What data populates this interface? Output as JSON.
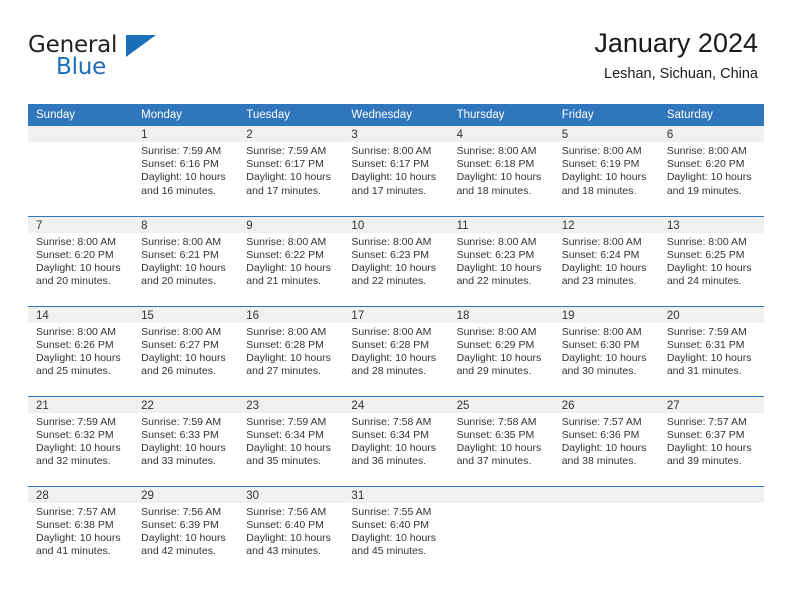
{
  "brand": {
    "word_one": "General",
    "word_two": "Blue",
    "triangle_icon": "triangle-right-icon",
    "accent_color": "#1b6fb8"
  },
  "header": {
    "title": "January 2024",
    "subtitle": "Leshan, Sichuan, China"
  },
  "calendar": {
    "header_bg": "#3076bd",
    "daynum_bg": "#f0f0f0",
    "columns": [
      "Sunday",
      "Monday",
      "Tuesday",
      "Wednesday",
      "Thursday",
      "Friday",
      "Saturday"
    ],
    "weeks": [
      [
        {
          "day": "",
          "lines": []
        },
        {
          "day": "1",
          "lines": [
            "Sunrise: 7:59 AM",
            "Sunset: 6:16 PM",
            "Daylight: 10 hours",
            "and 16 minutes."
          ]
        },
        {
          "day": "2",
          "lines": [
            "Sunrise: 7:59 AM",
            "Sunset: 6:17 PM",
            "Daylight: 10 hours",
            "and 17 minutes."
          ]
        },
        {
          "day": "3",
          "lines": [
            "Sunrise: 8:00 AM",
            "Sunset: 6:17 PM",
            "Daylight: 10 hours",
            "and 17 minutes."
          ]
        },
        {
          "day": "4",
          "lines": [
            "Sunrise: 8:00 AM",
            "Sunset: 6:18 PM",
            "Daylight: 10 hours",
            "and 18 minutes."
          ]
        },
        {
          "day": "5",
          "lines": [
            "Sunrise: 8:00 AM",
            "Sunset: 6:19 PM",
            "Daylight: 10 hours",
            "and 18 minutes."
          ]
        },
        {
          "day": "6",
          "lines": [
            "Sunrise: 8:00 AM",
            "Sunset: 6:20 PM",
            "Daylight: 10 hours",
            "and 19 minutes."
          ]
        }
      ],
      [
        {
          "day": "7",
          "lines": [
            "Sunrise: 8:00 AM",
            "Sunset: 6:20 PM",
            "Daylight: 10 hours",
            "and 20 minutes."
          ]
        },
        {
          "day": "8",
          "lines": [
            "Sunrise: 8:00 AM",
            "Sunset: 6:21 PM",
            "Daylight: 10 hours",
            "and 20 minutes."
          ]
        },
        {
          "day": "9",
          "lines": [
            "Sunrise: 8:00 AM",
            "Sunset: 6:22 PM",
            "Daylight: 10 hours",
            "and 21 minutes."
          ]
        },
        {
          "day": "10",
          "lines": [
            "Sunrise: 8:00 AM",
            "Sunset: 6:23 PM",
            "Daylight: 10 hours",
            "and 22 minutes."
          ]
        },
        {
          "day": "11",
          "lines": [
            "Sunrise: 8:00 AM",
            "Sunset: 6:23 PM",
            "Daylight: 10 hours",
            "and 22 minutes."
          ]
        },
        {
          "day": "12",
          "lines": [
            "Sunrise: 8:00 AM",
            "Sunset: 6:24 PM",
            "Daylight: 10 hours",
            "and 23 minutes."
          ]
        },
        {
          "day": "13",
          "lines": [
            "Sunrise: 8:00 AM",
            "Sunset: 6:25 PM",
            "Daylight: 10 hours",
            "and 24 minutes."
          ]
        }
      ],
      [
        {
          "day": "14",
          "lines": [
            "Sunrise: 8:00 AM",
            "Sunset: 6:26 PM",
            "Daylight: 10 hours",
            "and 25 minutes."
          ]
        },
        {
          "day": "15",
          "lines": [
            "Sunrise: 8:00 AM",
            "Sunset: 6:27 PM",
            "Daylight: 10 hours",
            "and 26 minutes."
          ]
        },
        {
          "day": "16",
          "lines": [
            "Sunrise: 8:00 AM",
            "Sunset: 6:28 PM",
            "Daylight: 10 hours",
            "and 27 minutes."
          ]
        },
        {
          "day": "17",
          "lines": [
            "Sunrise: 8:00 AM",
            "Sunset: 6:28 PM",
            "Daylight: 10 hours",
            "and 28 minutes."
          ]
        },
        {
          "day": "18",
          "lines": [
            "Sunrise: 8:00 AM",
            "Sunset: 6:29 PM",
            "Daylight: 10 hours",
            "and 29 minutes."
          ]
        },
        {
          "day": "19",
          "lines": [
            "Sunrise: 8:00 AM",
            "Sunset: 6:30 PM",
            "Daylight: 10 hours",
            "and 30 minutes."
          ]
        },
        {
          "day": "20",
          "lines": [
            "Sunrise: 7:59 AM",
            "Sunset: 6:31 PM",
            "Daylight: 10 hours",
            "and 31 minutes."
          ]
        }
      ],
      [
        {
          "day": "21",
          "lines": [
            "Sunrise: 7:59 AM",
            "Sunset: 6:32 PM",
            "Daylight: 10 hours",
            "and 32 minutes."
          ]
        },
        {
          "day": "22",
          "lines": [
            "Sunrise: 7:59 AM",
            "Sunset: 6:33 PM",
            "Daylight: 10 hours",
            "and 33 minutes."
          ]
        },
        {
          "day": "23",
          "lines": [
            "Sunrise: 7:59 AM",
            "Sunset: 6:34 PM",
            "Daylight: 10 hours",
            "and 35 minutes."
          ]
        },
        {
          "day": "24",
          "lines": [
            "Sunrise: 7:58 AM",
            "Sunset: 6:34 PM",
            "Daylight: 10 hours",
            "and 36 minutes."
          ]
        },
        {
          "day": "25",
          "lines": [
            "Sunrise: 7:58 AM",
            "Sunset: 6:35 PM",
            "Daylight: 10 hours",
            "and 37 minutes."
          ]
        },
        {
          "day": "26",
          "lines": [
            "Sunrise: 7:57 AM",
            "Sunset: 6:36 PM",
            "Daylight: 10 hours",
            "and 38 minutes."
          ]
        },
        {
          "day": "27",
          "lines": [
            "Sunrise: 7:57 AM",
            "Sunset: 6:37 PM",
            "Daylight: 10 hours",
            "and 39 minutes."
          ]
        }
      ],
      [
        {
          "day": "28",
          "lines": [
            "Sunrise: 7:57 AM",
            "Sunset: 6:38 PM",
            "Daylight: 10 hours",
            "and 41 minutes."
          ]
        },
        {
          "day": "29",
          "lines": [
            "Sunrise: 7:56 AM",
            "Sunset: 6:39 PM",
            "Daylight: 10 hours",
            "and 42 minutes."
          ]
        },
        {
          "day": "30",
          "lines": [
            "Sunrise: 7:56 AM",
            "Sunset: 6:40 PM",
            "Daylight: 10 hours",
            "and 43 minutes."
          ]
        },
        {
          "day": "31",
          "lines": [
            "Sunrise: 7:55 AM",
            "Sunset: 6:40 PM",
            "Daylight: 10 hours",
            "and 45 minutes."
          ]
        },
        {
          "day": "",
          "lines": []
        },
        {
          "day": "",
          "lines": []
        },
        {
          "day": "",
          "lines": []
        }
      ]
    ]
  }
}
